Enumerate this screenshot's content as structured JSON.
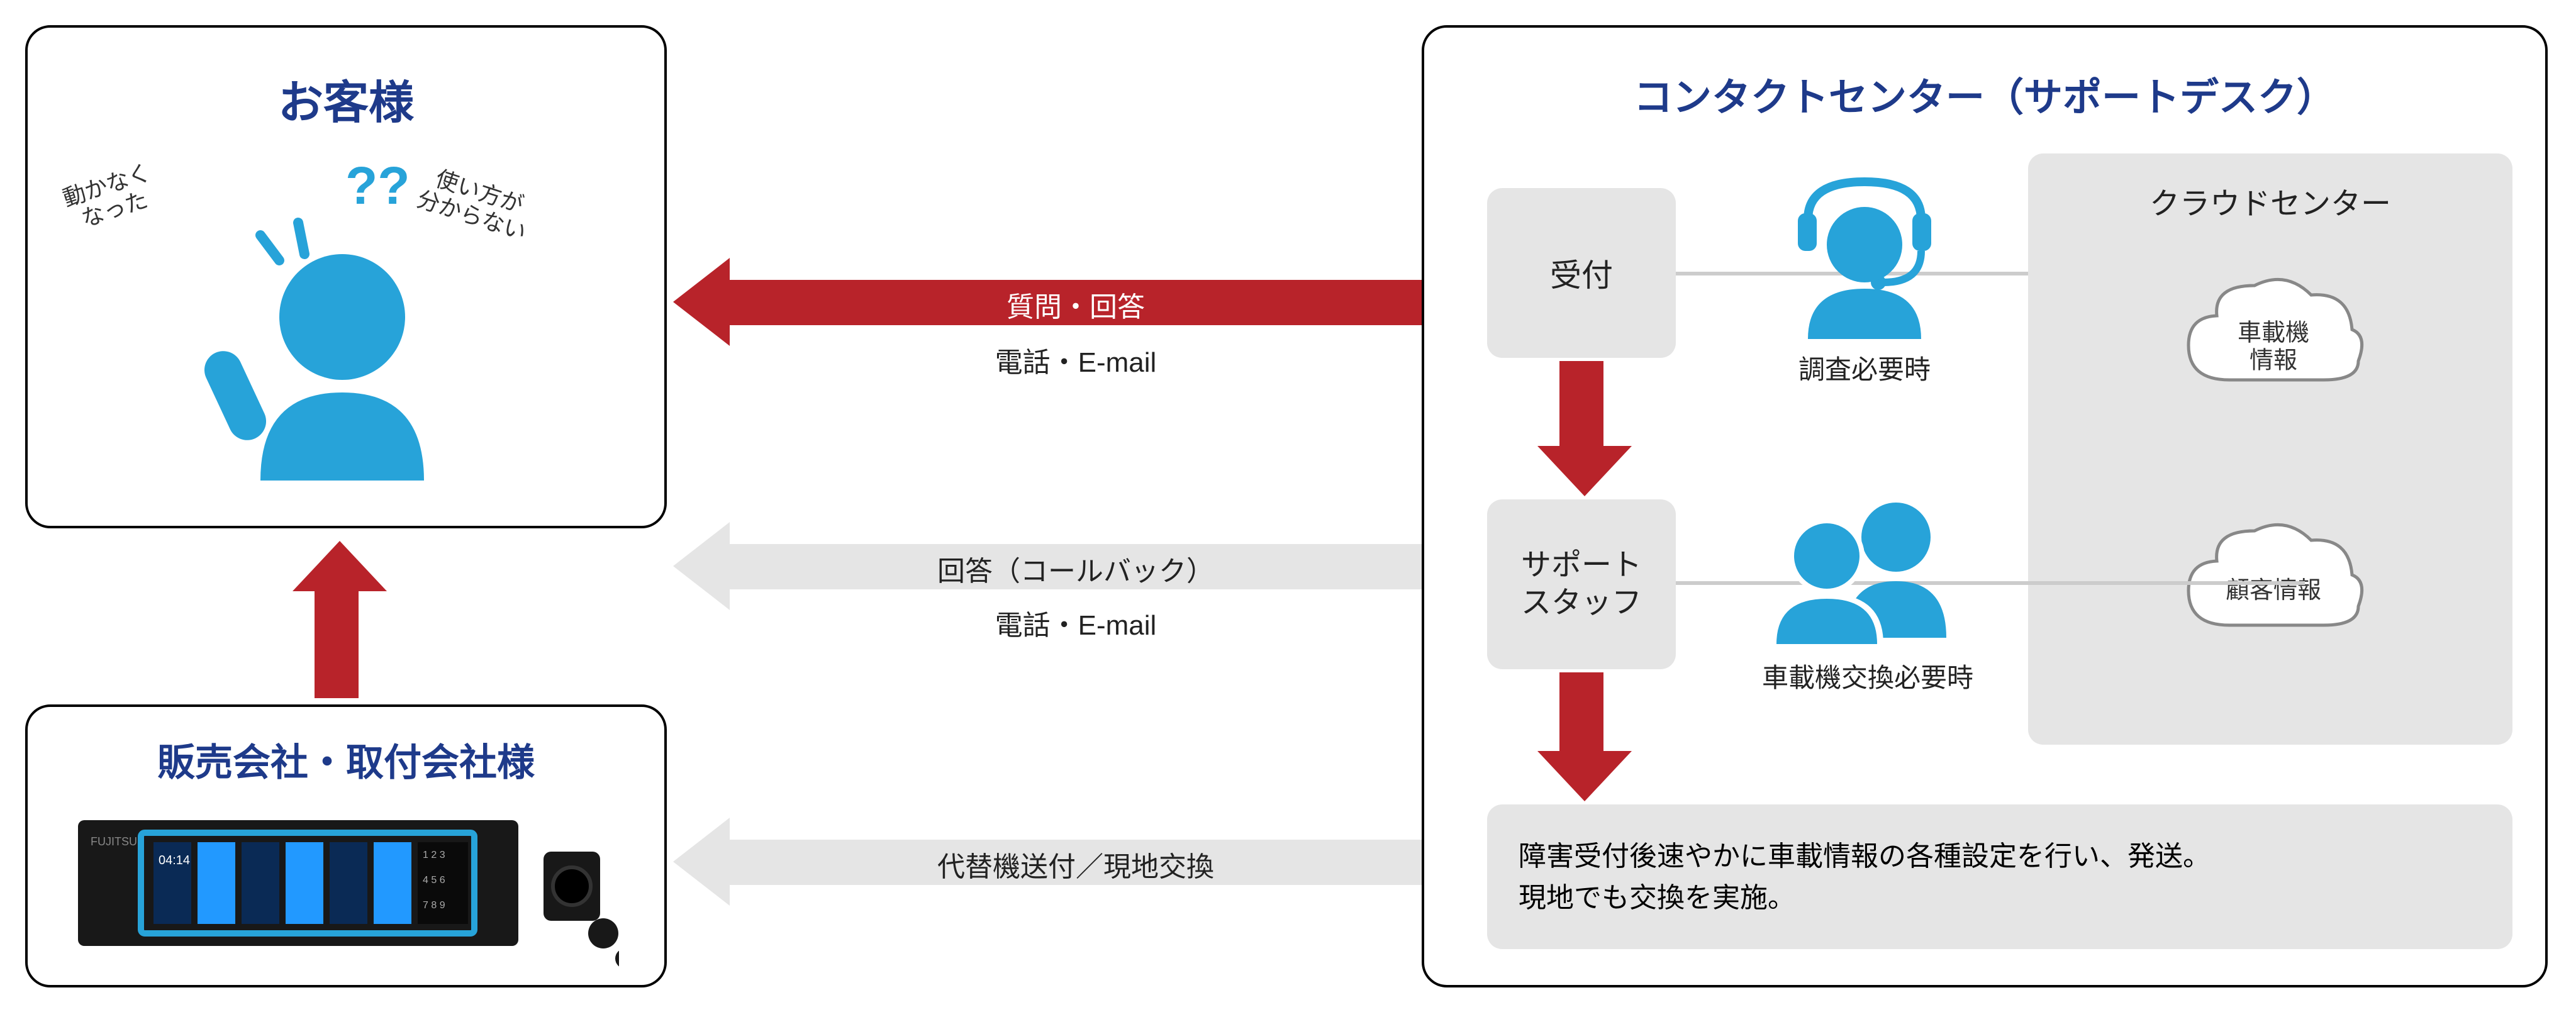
{
  "customer": {
    "title": "お客様",
    "bubble_left": "動かなく\nなった",
    "bubble_right": "使い方が\n分からない",
    "qmarks": "??"
  },
  "contact_center": {
    "title": "コンタクトセンター（サポートデスク）",
    "reception_label": "受付",
    "support_staff_label": "サポート\nスタッフ",
    "investigation_note": "調査必要時",
    "device_exchange_note": "車載機交換必要時",
    "cloud_center_label": "クラウドセンター",
    "cloud_device_info": "車載機\n情報",
    "cloud_customer_info": "顧客情報",
    "bottom_note": "障害受付後速やかに車載情報の各種設定を行い、発送。\n現地でも交換を実施。"
  },
  "sales_company": {
    "title": "販売会社・取付会社様"
  },
  "arrows": {
    "qa_title": "質問・回答",
    "qa_sub": "電話・E-mail",
    "callback_title": "回答（コールバック）",
    "callback_sub": "電話・E-mail",
    "replacement": "代替機送付／現地交換"
  },
  "colors": {
    "accent_red": "#b8232a",
    "accent_blue": "#27a3d9",
    "title_navy": "#1e3a8a",
    "grey_fill": "#e5e5e5"
  }
}
